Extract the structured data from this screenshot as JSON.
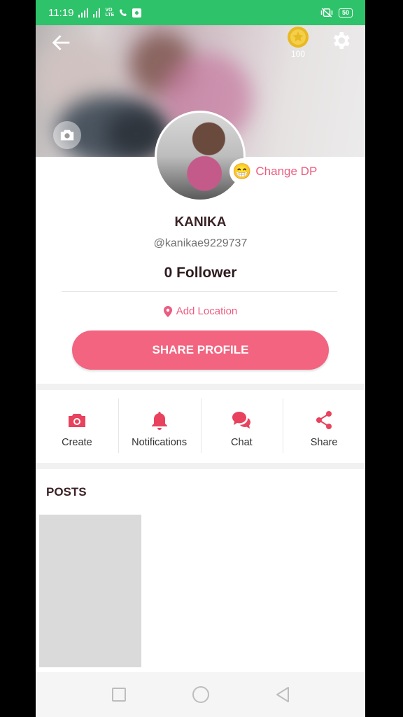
{
  "status_bar": {
    "time": "11:19",
    "network_label": "VoLTE",
    "battery": "50"
  },
  "cover": {
    "coin_count": "100"
  },
  "profile": {
    "change_dp_label": "Change DP",
    "change_dp_emoji": "😁",
    "name": "KANIKA",
    "handle": "@kanikae9229737",
    "followers": "0 Follower",
    "add_location": "Add Location",
    "share_profile": "SHARE PROFILE"
  },
  "actions": [
    {
      "label": "Create",
      "icon": "camera-icon"
    },
    {
      "label": "Notifications",
      "icon": "bell-icon"
    },
    {
      "label": "Chat",
      "icon": "chat-bubbles-icon"
    },
    {
      "label": "Share",
      "icon": "share-icon"
    }
  ],
  "posts": {
    "title": "POSTS"
  },
  "colors": {
    "status_bar": "#2ec26a",
    "accent_pink": "#f2647f",
    "accent_text": "#ec5b80",
    "icon_red": "#e8425e"
  }
}
